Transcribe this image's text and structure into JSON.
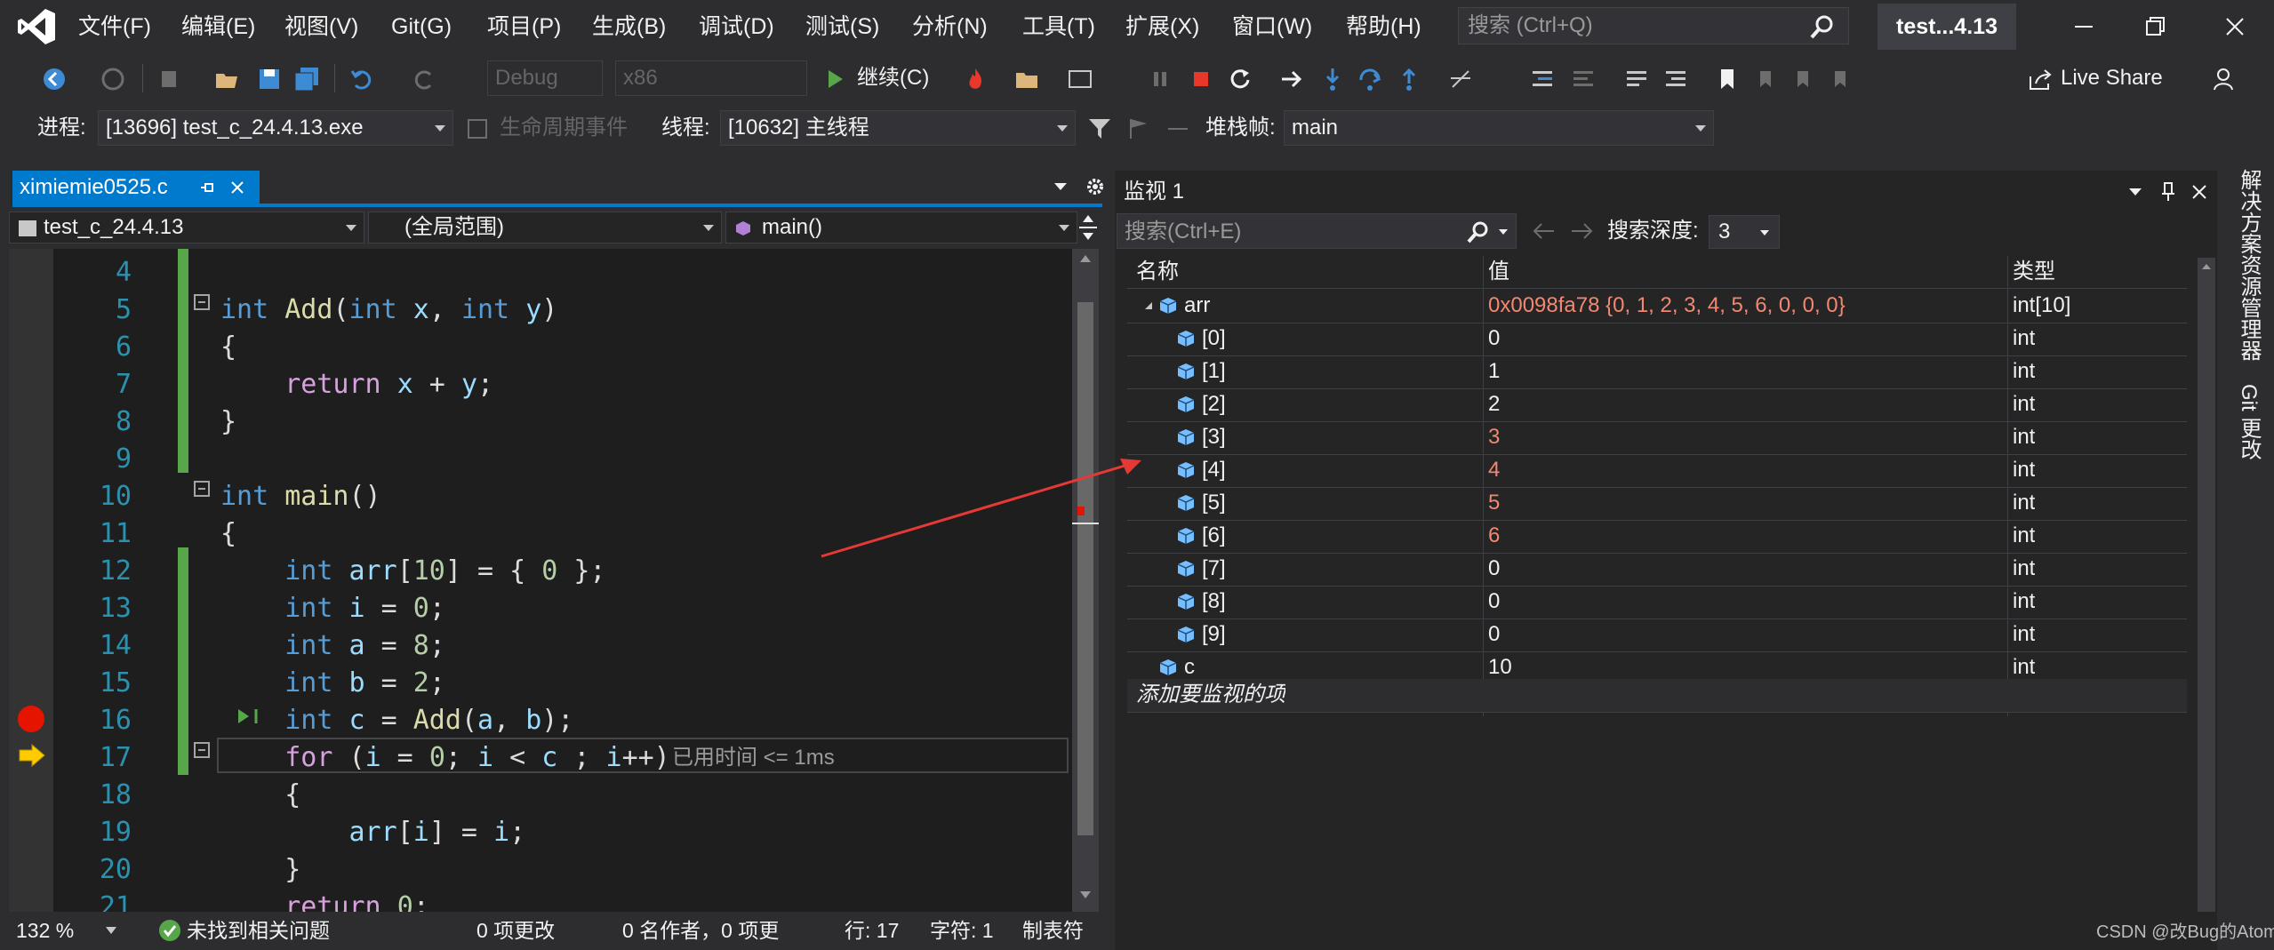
{
  "menu": [
    "文件(F)",
    "编辑(E)",
    "视图(V)",
    "Git(G)",
    "项目(P)",
    "生成(B)",
    "调试(D)",
    "测试(S)",
    "分析(N)",
    "工具(T)",
    "扩展(X)",
    "窗口(W)",
    "帮助(H)"
  ],
  "search": {
    "placeholder": "搜索 (Ctrl+Q)"
  },
  "solution_title": "test...4.13",
  "toolbar": {
    "config": "Debug",
    "platform": "x86",
    "continue_label": "继续(C)",
    "live_share": "Live Share"
  },
  "debug_bar": {
    "process_label": "进程:",
    "process_value": "[13696] test_c_24.4.13.exe",
    "lifecycle_label": "生命周期事件",
    "thread_label": "线程:",
    "thread_value": "[10632] 主线程",
    "stack_label": "堆栈帧:",
    "stack_value": "main"
  },
  "editor": {
    "tab": "ximiemie0525.c",
    "project_combo": "test_c_24.4.13",
    "scope_combo": "(全局范围)",
    "function_combo": "main()",
    "line_numbers": [
      "4",
      "5",
      "6",
      "7",
      "8",
      "9",
      "10",
      "11",
      "12",
      "13",
      "14",
      "15",
      "16",
      "17",
      "18",
      "19",
      "20",
      "21"
    ],
    "elapsed_hint": "已用时间 <= 1ms",
    "zoom": "132 %",
    "issues": "未找到相关问题",
    "changes": "0 项更改",
    "authors": "0 名作者，0 项更",
    "position": "行: 17",
    "char": "字符: 1",
    "tabs_mode": "制表符"
  },
  "watch": {
    "title": "监视 1",
    "search_placeholder": "搜索(Ctrl+E)",
    "depth_label": "搜索深度:",
    "depth_value": "3",
    "columns": [
      "名称",
      "值",
      "类型"
    ],
    "rows": [
      {
        "name": "arr",
        "value": "0x0098fa78 {0, 1, 2, 3, 4, 5, 6, 0, 0, 0}",
        "type": "int[10]",
        "changed": true
      },
      {
        "name": "[0]",
        "value": "0",
        "type": "int",
        "changed": false
      },
      {
        "name": "[1]",
        "value": "1",
        "type": "int",
        "changed": false
      },
      {
        "name": "[2]",
        "value": "2",
        "type": "int",
        "changed": false
      },
      {
        "name": "[3]",
        "value": "3",
        "type": "int",
        "changed": true
      },
      {
        "name": "[4]",
        "value": "4",
        "type": "int",
        "changed": true
      },
      {
        "name": "[5]",
        "value": "5",
        "type": "int",
        "changed": true
      },
      {
        "name": "[6]",
        "value": "6",
        "type": "int",
        "changed": true
      },
      {
        "name": "[7]",
        "value": "0",
        "type": "int",
        "changed": false
      },
      {
        "name": "[8]",
        "value": "0",
        "type": "int",
        "changed": false
      },
      {
        "name": "[9]",
        "value": "0",
        "type": "int",
        "changed": false
      },
      {
        "name": "c",
        "value": "10",
        "type": "int",
        "changed": false
      }
    ],
    "add_item": "添加要监视的项"
  },
  "side_rail": [
    "解决方案资源管理器",
    "Git 更改"
  ],
  "watermark": "CSDN @改Bug的Atom",
  "colors": {
    "accent": "#007acc",
    "changed_value": "#f48771",
    "annotation_arrow": "#e53935"
  }
}
